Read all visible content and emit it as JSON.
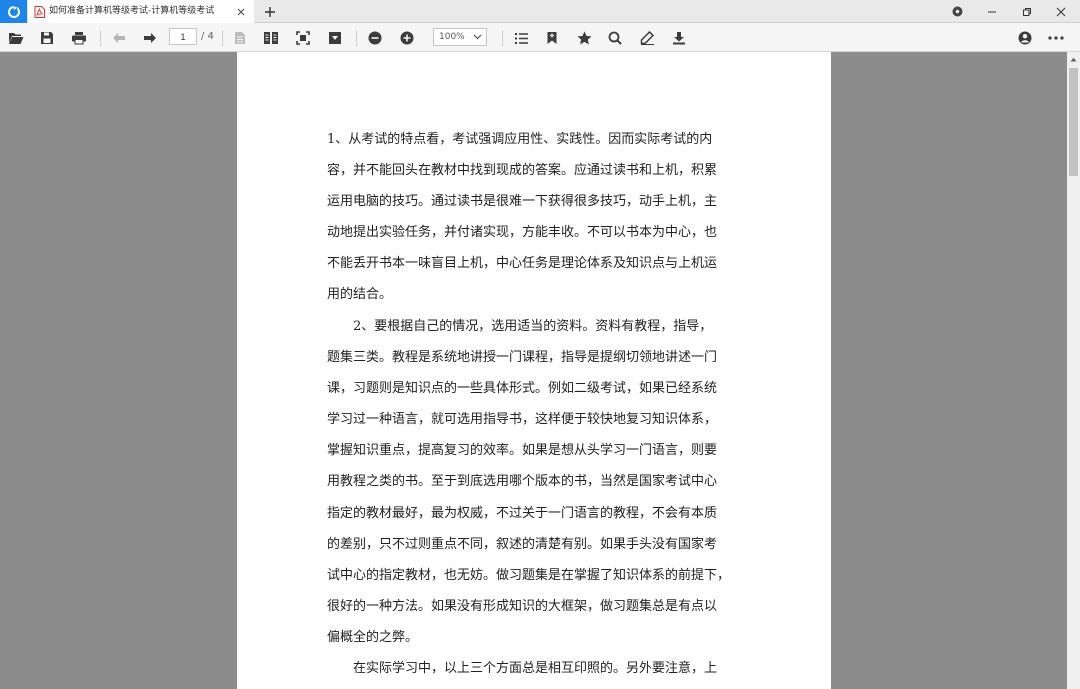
{
  "tab": {
    "title": "如何准备计算机等级考试-计算机等级考试"
  },
  "toolbar": {
    "page_current": "1",
    "page_total": "/ 4",
    "zoom": "100%"
  },
  "colors": {
    "accent": "#1e86e8",
    "pdf_icon": "#d9362b"
  },
  "icons": {
    "app": "refresh-icon",
    "pdf": "pdf-file-icon",
    "close": "close-icon",
    "new_tab": "plus-icon",
    "open": "folder-open-icon",
    "save": "save-icon",
    "print": "printer-icon",
    "back": "arrow-left-icon",
    "forward": "arrow-right-icon",
    "single_page": "single-page-icon",
    "two_page": "two-page-icon",
    "fit": "fit-page-icon",
    "rotate": "rotate-page-icon",
    "zoom_out": "zoom-out-icon",
    "zoom_in": "zoom-in-icon",
    "outline": "outline-list-icon",
    "bookmark": "bookmark-icon",
    "star": "star-icon",
    "search": "search-icon",
    "annotate": "pen-icon",
    "download": "download-icon",
    "account": "user-icon",
    "more": "more-icon"
  },
  "document": {
    "paragraphs": [
      {
        "lines": [
          "1、从考试的特点看，考试强调应用性、实践性。因而实际考试的内",
          "容，并不能回头在教材中找到现成的答案。应通过读书和上机，积累",
          "运用电脑的技巧。通过读书是很难一下获得很多技巧，动手上机，主",
          "动地提出实验任务，并付诸实现，方能丰收。不可以书本为中心，也",
          "不能丢开书本一味盲目上机，中心任务是理论体系及知识点与上机运",
          "用的结合。"
        ]
      },
      {
        "lines": [
          "　　2、要根据自己的情况，选用适当的资料。资料有教程，指导，",
          "题集三类。教程是系统地讲授一门课程，指导是提纲切领地讲述一门",
          "课，习题则是知识点的一些具体形式。例如二级考试，如果已经系统",
          "学习过一种语言，就可选用指导书，这样便于较快地复习知识体系，",
          "掌握知识重点，提高复习的效率。如果是想从头学习一门语言，则要",
          "用教程之类的书。至于到底选用哪个版本的书，当然是国家考试中心",
          "指定的教材最好，最为权威，不过关于一门语言的教程，不会有本质",
          "的差别，只不过则重点不同，叙述的清楚有别。如果手头没有国家考",
          "试中心的指定教材，也无妨。做习题集是在掌握了知识体系的前提下，",
          "很好的一种方法。如果没有形成知识的大框架，做习题集总是有点以",
          "偏概全的之弊。"
        ]
      },
      {
        "lines": [
          "　　在实际学习中，以上三个方面总是相互印照的。另外要注意，上"
        ]
      }
    ]
  }
}
